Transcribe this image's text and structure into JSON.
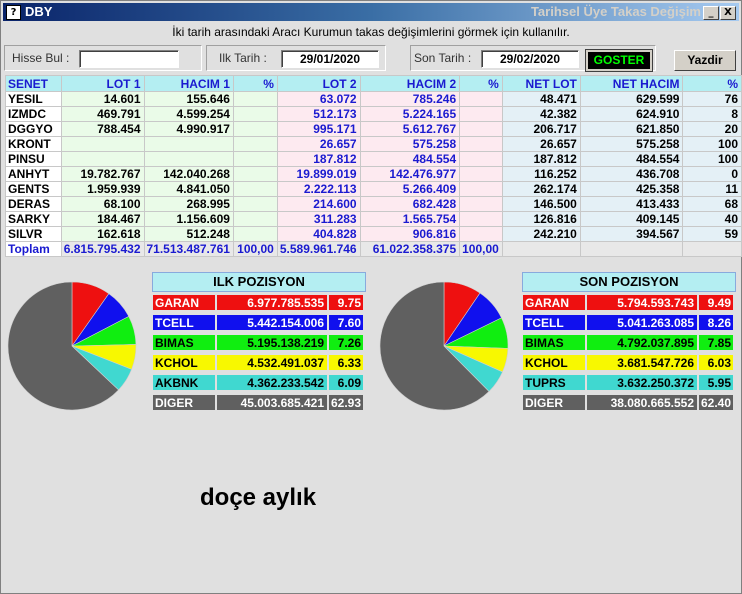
{
  "window": {
    "icon_label": "?",
    "title": "DBY",
    "right_title": "Tarihsel Üye Takas Değişim",
    "min_label": "_",
    "close_label": "X"
  },
  "hint": "İki tarih arasındaki  Aracı Kurumun takas değişimlerini görmek için kullanılır.",
  "search": {
    "label": "Hisse Bul :",
    "value": ""
  },
  "start_date": {
    "label": "Ilk Tarih :",
    "value": "29/01/2020"
  },
  "end_date": {
    "label": "Son Tarih :",
    "value": "29/02/2020"
  },
  "goster_label": "GOSTER",
  "yazdir_label": "Yazdir",
  "table": {
    "headers": [
      "SENET",
      "LOT 1",
      "HACIM 1",
      "%",
      "LOT 2",
      "HACIM 2",
      "%",
      "NET LOT",
      "NET HACIM",
      "%"
    ],
    "rows": [
      [
        "YESIL",
        "14.601",
        "155.646",
        "",
        "63.072",
        "785.246",
        "",
        "48.471",
        "629.599",
        "76"
      ],
      [
        "IZMDC",
        "469.791",
        "4.599.254",
        "",
        "512.173",
        "5.224.165",
        "",
        "42.382",
        "624.910",
        "8"
      ],
      [
        "DGGYO",
        "788.454",
        "4.990.917",
        "",
        "995.171",
        "5.612.767",
        "",
        "206.717",
        "621.850",
        "20"
      ],
      [
        "KRONT",
        "",
        "",
        "",
        "26.657",
        "575.258",
        "",
        "26.657",
        "575.258",
        "100"
      ],
      [
        "PINSU",
        "",
        "",
        "",
        "187.812",
        "484.554",
        "",
        "187.812",
        "484.554",
        "100"
      ],
      [
        "ANHYT",
        "19.782.767",
        "142.040.268",
        "",
        "19.899.019",
        "142.476.977",
        "",
        "116.252",
        "436.708",
        "0"
      ],
      [
        "GENTS",
        "1.959.939",
        "4.841.050",
        "",
        "2.222.113",
        "5.266.409",
        "",
        "262.174",
        "425.358",
        "11"
      ],
      [
        "DERAS",
        "68.100",
        "268.995",
        "",
        "214.600",
        "682.428",
        "",
        "146.500",
        "413.433",
        "68"
      ],
      [
        "SARKY",
        "184.467",
        "1.156.609",
        "",
        "311.283",
        "1.565.754",
        "",
        "126.816",
        "409.145",
        "40"
      ],
      [
        "SILVR",
        "162.618",
        "512.248",
        "",
        "404.828",
        "906.816",
        "",
        "242.210",
        "394.567",
        "59"
      ]
    ],
    "total": [
      "Toplam",
      "6.815.795.432",
      "71.513.487.761",
      "100,00",
      "5.589.961.746",
      "61.022.358.375",
      "100,00",
      "",
      "",
      ""
    ]
  },
  "ilk": {
    "title": "ILK POZISYON",
    "rows": [
      {
        "name": "GARAN",
        "value": "6.977.785.535",
        "pct": "9.75",
        "pct_num": 9.75,
        "bg": "#ee1010",
        "fg": "#ffffff"
      },
      {
        "name": "TCELL",
        "value": "5.442.154.006",
        "pct": "7.60",
        "pct_num": 7.6,
        "bg": "#1010ee",
        "fg": "#ffffff"
      },
      {
        "name": "BIMAS",
        "value": "5.195.138.219",
        "pct": "7.26",
        "pct_num": 7.26,
        "bg": "#10ee10",
        "fg": "#000000"
      },
      {
        "name": "KCHOL",
        "value": "4.532.491.037",
        "pct": "6.33",
        "pct_num": 6.33,
        "bg": "#f8f800",
        "fg": "#000000"
      },
      {
        "name": "AKBNK",
        "value": "4.362.233.542",
        "pct": "6.09",
        "pct_num": 6.09,
        "bg": "#40d8d0",
        "fg": "#000000"
      },
      {
        "name": "DIGER",
        "value": "45.003.685.421",
        "pct": "62.93",
        "pct_num": 62.93,
        "bg": "#606060",
        "fg": "#ffffff"
      }
    ]
  },
  "son": {
    "title": "SON POZISYON",
    "rows": [
      {
        "name": "GARAN",
        "value": "5.794.593.743",
        "pct": "9.49",
        "pct_num": 9.49,
        "bg": "#ee1010",
        "fg": "#ffffff"
      },
      {
        "name": "TCELL",
        "value": "5.041.263.085",
        "pct": "8.26",
        "pct_num": 8.26,
        "bg": "#1010ee",
        "fg": "#ffffff"
      },
      {
        "name": "BIMAS",
        "value": "4.792.037.895",
        "pct": "7.85",
        "pct_num": 7.85,
        "bg": "#10ee10",
        "fg": "#000000"
      },
      {
        "name": "KCHOL",
        "value": "3.681.547.726",
        "pct": "6.03",
        "pct_num": 6.03,
        "bg": "#f8f800",
        "fg": "#000000"
      },
      {
        "name": "TUPRS",
        "value": "3.632.250.372",
        "pct": "5.95",
        "pct_num": 5.95,
        "bg": "#40d8d0",
        "fg": "#000000"
      },
      {
        "name": "DIGER",
        "value": "38.080.665.552",
        "pct": "62.40",
        "pct_num": 62.4,
        "bg": "#606060",
        "fg": "#ffffff"
      }
    ]
  },
  "overlay_text": "doçe aylık"
}
